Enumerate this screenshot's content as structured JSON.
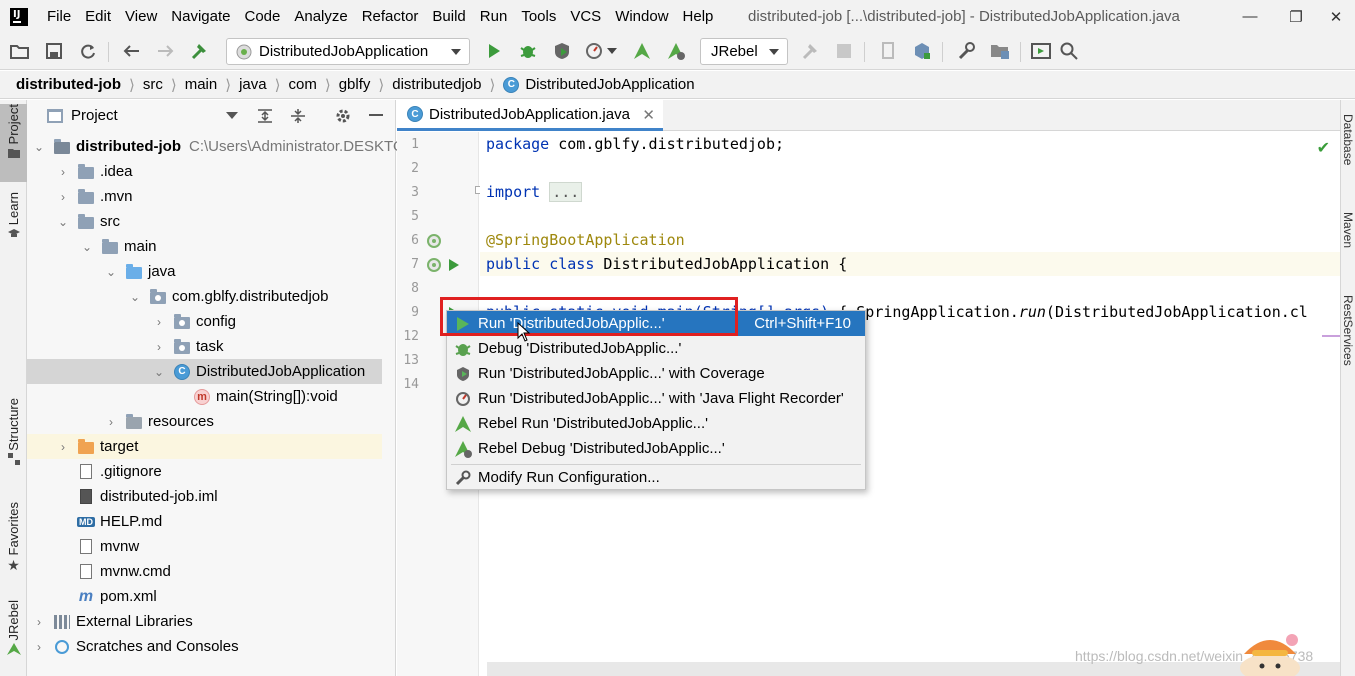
{
  "app": {
    "window_title": "distributed-job [...\\distributed-job] - DistributedJobApplication.java"
  },
  "menu": [
    "File",
    "Edit",
    "View",
    "Navigate",
    "Code",
    "Analyze",
    "Refactor",
    "Build",
    "Run",
    "Tools",
    "VCS",
    "Window",
    "Help"
  ],
  "toolbar": {
    "run_config": "DistributedJobApplication",
    "jrebel": "JRebel"
  },
  "breadcrumb": [
    "distributed-job",
    "src",
    "main",
    "java",
    "com",
    "gblfy",
    "distributedjob",
    "DistributedJobApplication"
  ],
  "left_strip": {
    "project": "Project",
    "learn": "Learn",
    "structure": "Structure",
    "favorites": "Favorites",
    "jrebel": "JRebel"
  },
  "right_strip": {
    "database": "Database",
    "maven": "Maven",
    "restservices": "RestServices"
  },
  "project_panel": {
    "title": "Project",
    "tree": [
      {
        "label": "distributed-job",
        "extra": "C:\\Users\\Administrator.DESKTO"
      },
      {
        "label": ".idea"
      },
      {
        "label": ".mvn"
      },
      {
        "label": "src"
      },
      {
        "label": "main"
      },
      {
        "label": "java"
      },
      {
        "label": "com.gblfy.distributedjob"
      },
      {
        "label": "config"
      },
      {
        "label": "task"
      },
      {
        "label": "DistributedJobApplication"
      },
      {
        "label": "main(String[]):void"
      },
      {
        "label": "resources"
      },
      {
        "label": "target"
      },
      {
        "label": ".gitignore"
      },
      {
        "label": "distributed-job.iml"
      },
      {
        "label": "HELP.md"
      },
      {
        "label": "mvnw"
      },
      {
        "label": "mvnw.cmd"
      },
      {
        "label": "pom.xml"
      },
      {
        "label": "External Libraries"
      },
      {
        "label": "Scratches and Consoles"
      }
    ]
  },
  "editor": {
    "tab": "DistributedJobApplication.java",
    "line_numbers": [
      "1",
      "2",
      "3",
      "5",
      "6",
      "7",
      "8",
      "9",
      "12",
      "13",
      "14"
    ],
    "code": {
      "l1_kw": "package",
      "l1_rest": " com.gblfy.distributedjob;",
      "l3_kw": "import",
      "l3_fold": "...",
      "l6": "@SpringBootApplication",
      "l7_kw": "public class",
      "l7_rest": " DistributedJobApplication {",
      "l9_left": "public static void main(String[] args)",
      "l9_right": "{ SpringApplication.",
      "l9_run": "run",
      "l9_tail": "(DistributedJobApplication.cl"
    }
  },
  "context_menu": {
    "items": [
      {
        "label": "Run 'DistributedJobApplic...'",
        "shortcut": "Ctrl+Shift+F10"
      },
      {
        "label": "Debug 'DistributedJobApplic...'"
      },
      {
        "label": "Run 'DistributedJobApplic...' with Coverage"
      },
      {
        "label": "Run 'DistributedJobApplic...' with 'Java Flight Recorder'"
      },
      {
        "label": "Rebel Run 'DistributedJobApplic...'"
      },
      {
        "label": "Rebel Debug 'DistributedJobApplic...'"
      },
      {
        "label": "Modify Run Configuration..."
      }
    ]
  },
  "watermark": "https://blog.csdn.net/weixin_40816738",
  "colors": {
    "selection": "#2675bf",
    "highlight_box": "#e02020",
    "keyword": "#0033b3",
    "annotation": "#9e880d"
  }
}
